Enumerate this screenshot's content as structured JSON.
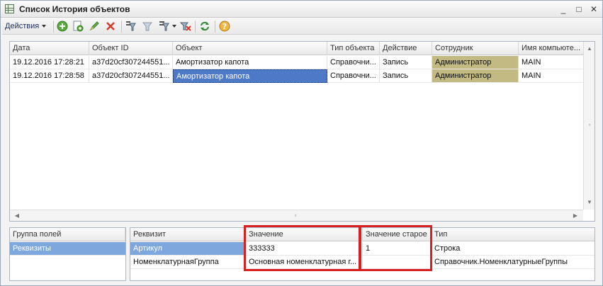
{
  "window": {
    "title": "Список История объектов",
    "min": "_",
    "max": "□",
    "close": "✕"
  },
  "toolbar": {
    "actions_label": "Действия"
  },
  "main_table": {
    "columns": [
      "Дата",
      "Объект ID",
      "Объект",
      "Тип объекта",
      "Действие",
      "Сотрудник",
      "Имя компьюте..."
    ],
    "rows": [
      [
        "19.12.2016 17:28:21",
        "a37d20cf307244551...",
        "Амортизатор капота",
        "Справочни...",
        "Запись",
        "Администратор",
        "MAIN"
      ],
      [
        "19.12.2016 17:28:58",
        "a37d20cf307244551...",
        "Амортизатор капота",
        "Справочни...",
        "Запись",
        "Администратор",
        "MAIN"
      ]
    ]
  },
  "groups_table": {
    "header": "Группа полей",
    "rows": [
      "Реквизиты"
    ]
  },
  "details_table": {
    "columns": [
      "Реквизит",
      "Значение",
      "Значение старое",
      "Тип"
    ],
    "rows": [
      [
        "Артикул",
        "333333",
        "1",
        "Строка"
      ],
      [
        "НоменклатурнаяГруппа",
        "Основная номенклатурная г...",
        "",
        "Справочник.НоменклатурныеГруппы"
      ]
    ]
  },
  "colors": {
    "accent_red": "#d92020",
    "selection_blue": "#4d79c6",
    "highlight_olive": "#c2b983"
  }
}
